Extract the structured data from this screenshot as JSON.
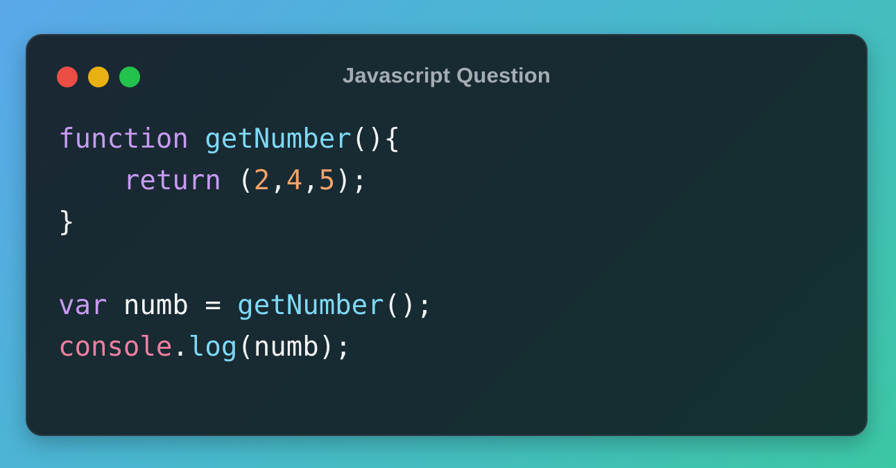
{
  "window": {
    "title": "Javascript Question",
    "traffic_lights": [
      {
        "name": "close",
        "color": "#ec4d45"
      },
      {
        "name": "minimize",
        "color": "#e9b011"
      },
      {
        "name": "maximize",
        "color": "#22c24d"
      }
    ]
  },
  "colors": {
    "keyword": "#c79bf2",
    "function": "#7fd8f4",
    "number": "#f3a36a",
    "object": "#f27ea2",
    "plain": "#f2f4f5"
  },
  "code": {
    "line1": {
      "kw": "function",
      "sp": " ",
      "fn": "getNumber",
      "rest": "(){"
    },
    "line2": {
      "indent": "    ",
      "kw": "return",
      "open": " (",
      "n1": "2",
      "c1": ",",
      "n2": "4",
      "c2": ",",
      "n3": "5",
      "close": ");"
    },
    "line3": {
      "text": "}"
    },
    "line4": {
      "text": ""
    },
    "line5": {
      "kw": "var",
      "mid": " numb = ",
      "fn": "getNumber",
      "rest": "();"
    },
    "line6": {
      "obj": "console",
      "dot": ".",
      "fn": "log",
      "rest": "(numb);"
    }
  }
}
